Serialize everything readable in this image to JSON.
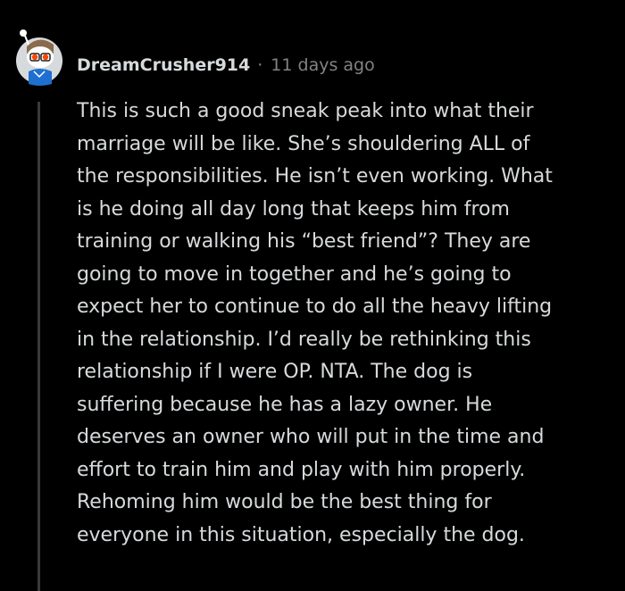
{
  "comment": {
    "username": "DreamCrusher914",
    "separator": "·",
    "timestamp": "11 days ago",
    "body_lines": [
      "This is such a good sneak peak into what their",
      "marriage will be like. She’s shouldering ALL of",
      "the responsibilities. He isn’t even working. What",
      "is he doing all day long that keeps him from",
      "training or walking his “best friend”? They are",
      "going to move in together and he’s going to",
      "expect her to continue to do all the heavy lifting",
      "in the relationship. I’d really be rethinking this",
      "relationship if I were OP. NTA. The dog is",
      "suffering because he has a lazy owner. He",
      "deserves an owner who will put in the time and",
      "effort to train him and play with him properly.",
      "Rehoming him would be the best thing for",
      "everyone in this situation, especially the dog."
    ]
  },
  "colors": {
    "background": "#000000",
    "text": "#d7dadc",
    "meta": "#818384",
    "thread_line": "#3a3a3a"
  },
  "icons": {
    "avatar": "user-avatar-icon"
  }
}
